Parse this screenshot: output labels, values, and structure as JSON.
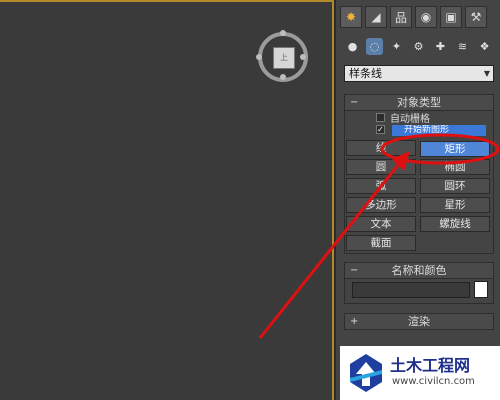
{
  "command_panel": {
    "tabs": [
      {
        "icon": "create-icon"
      },
      {
        "icon": "modify-icon"
      },
      {
        "icon": "hierarchy-icon"
      },
      {
        "icon": "motion-icon"
      },
      {
        "icon": "display-icon"
      },
      {
        "icon": "utilities-icon"
      }
    ],
    "category_icons": [
      {
        "icon": "geometry-icon"
      },
      {
        "icon": "shapes-icon",
        "active": true
      },
      {
        "icon": "lights-icon"
      },
      {
        "icon": "cameras-icon"
      },
      {
        "icon": "helpers-icon"
      },
      {
        "icon": "spacewarps-icon"
      },
      {
        "icon": "systems-icon"
      }
    ],
    "dropdown": {
      "selected": "样条线"
    },
    "object_type": {
      "title": "对象类型",
      "autogrid_label": "自动栅格",
      "start_new_shape_label": "开始新图形",
      "buttons": [
        "线",
        "矩形",
        "圆",
        "椭圆",
        "弧",
        "圆环",
        "多边形",
        "星形",
        "文本",
        "螺旋线",
        "截面"
      ],
      "selected": "矩形"
    },
    "name_color": {
      "title": "名称和颜色",
      "swatch_color": "#ffffff"
    },
    "rendering": {
      "title": "渲染"
    }
  },
  "viewport": {
    "viewcube_face": "上"
  },
  "watermark": {
    "site_name": "土木工程网",
    "url": "www.civilcn.com"
  },
  "colors": {
    "accent": "#f1b13b",
    "selection": "#4f86d8",
    "annotation": "#e01010"
  }
}
